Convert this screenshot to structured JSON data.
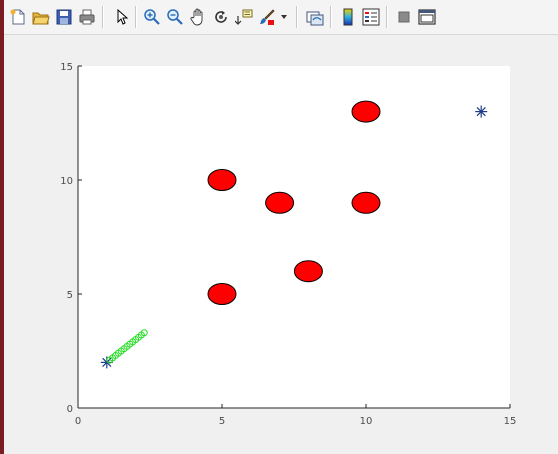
{
  "toolbar": {
    "buttons": [
      {
        "name": "new-figure-icon",
        "icon": "new-file"
      },
      {
        "name": "open-file-icon",
        "icon": "folder-open"
      },
      {
        "name": "save-figure-icon",
        "icon": "floppy-disk"
      },
      {
        "name": "print-figure-icon",
        "icon": "printer"
      },
      {
        "name": "edit-plot-icon",
        "icon": "arrow-pointer"
      },
      {
        "name": "zoom-in-icon",
        "icon": "magnifier-plus"
      },
      {
        "name": "zoom-out-icon",
        "icon": "magnifier-minus"
      },
      {
        "name": "pan-icon",
        "icon": "hand"
      },
      {
        "name": "rotate-3d-icon",
        "icon": "rotate"
      },
      {
        "name": "data-cursor-icon",
        "icon": "data-tip"
      },
      {
        "name": "brush-icon",
        "icon": "brush"
      },
      {
        "name": "brush-dropdown-icon",
        "icon": "chevron-down"
      },
      {
        "name": "link-plot-icon",
        "icon": "link"
      },
      {
        "name": "insert-colorbar-icon",
        "icon": "colorbar"
      },
      {
        "name": "insert-legend-icon",
        "icon": "legend"
      },
      {
        "name": "hide-plot-tools-icon",
        "icon": "square-gray"
      },
      {
        "name": "show-plot-tools-icon",
        "icon": "window-frame"
      }
    ]
  },
  "chart_data": {
    "type": "scatter",
    "xlim": [
      0,
      15
    ],
    "ylim": [
      0,
      15
    ],
    "xticks": [
      "0",
      "5",
      "10",
      "15"
    ],
    "yticks": [
      "0",
      "5",
      "10",
      "15"
    ],
    "grid": false,
    "series": [
      {
        "marker": "filled-ellipse",
        "color": "#ff0000",
        "edge_color": "#000000",
        "points": [
          [
            5,
            10
          ],
          [
            7,
            9
          ],
          [
            10,
            13
          ],
          [
            10,
            9
          ],
          [
            8,
            6
          ],
          [
            5,
            5
          ]
        ]
      },
      {
        "marker": "asterisk",
        "color": "#1f3c88",
        "points": [
          [
            1,
            2
          ],
          [
            14,
            13
          ]
        ]
      },
      {
        "marker": "circle-open",
        "color": "#22dd22",
        "points": [
          [
            1.1,
            2.1
          ],
          [
            1.2,
            2.2
          ],
          [
            1.3,
            2.3
          ],
          [
            1.4,
            2.4
          ],
          [
            1.5,
            2.5
          ],
          [
            1.6,
            2.6
          ],
          [
            1.7,
            2.7
          ],
          [
            1.8,
            2.8
          ],
          [
            1.9,
            2.9
          ],
          [
            2.0,
            3.0
          ],
          [
            2.1,
            3.1
          ],
          [
            2.2,
            3.2
          ],
          [
            2.3,
            3.3
          ]
        ]
      }
    ]
  }
}
